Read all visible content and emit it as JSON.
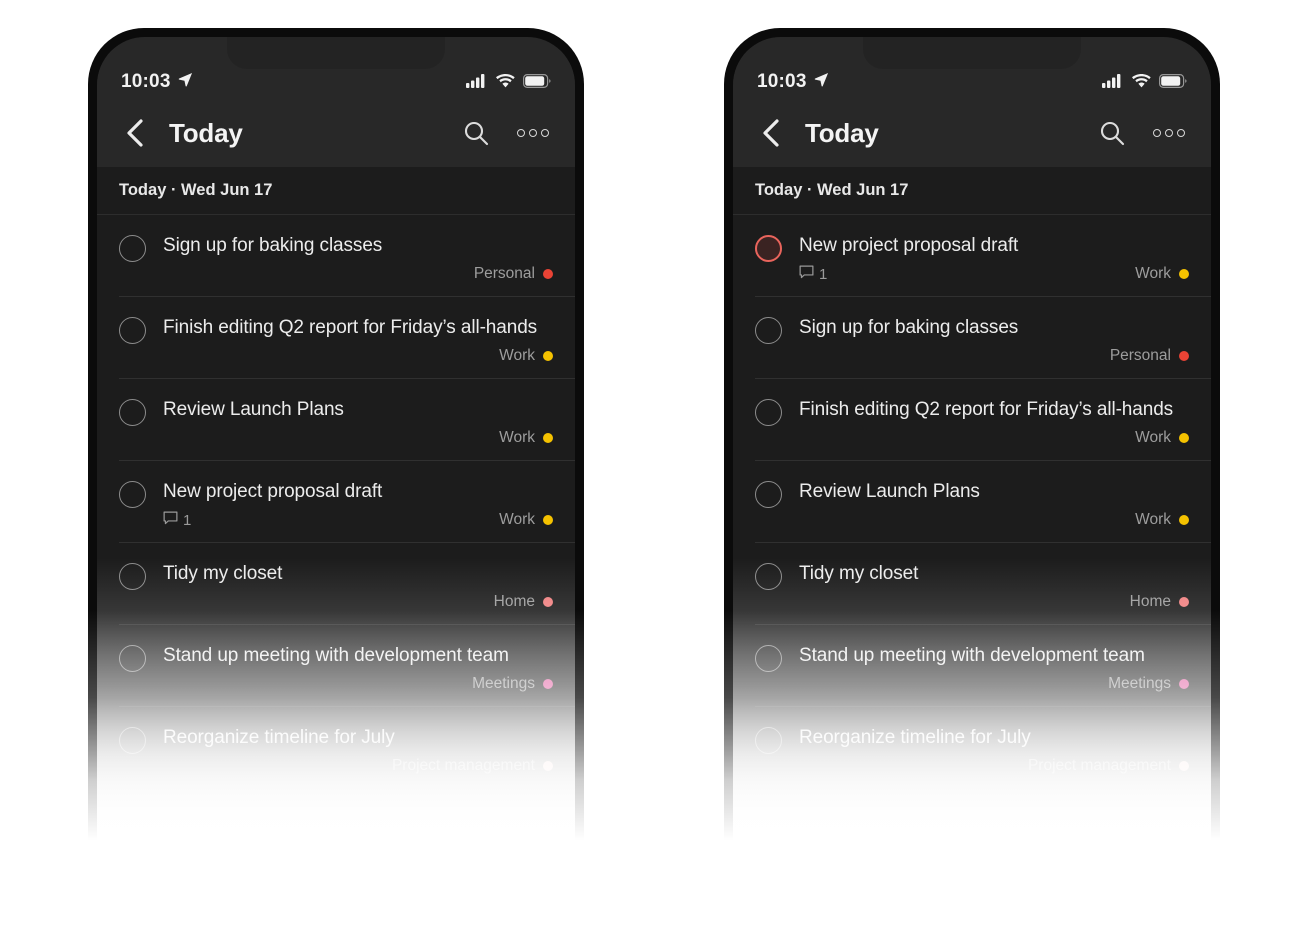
{
  "statusbar": {
    "time": "10:03",
    "location_icon": "location-arrow-icon",
    "signal_icon": "cellular-signal-icon",
    "wifi_icon": "wifi-icon",
    "battery_icon": "battery-icon"
  },
  "navbar": {
    "back_icon": "chevron-left-icon",
    "title": "Today",
    "search_icon": "search-icon",
    "more_icon": "more-options-icon"
  },
  "section": {
    "header": "Today · Wed Jun 17"
  },
  "colors": {
    "personal": "#e94335",
    "work": "#f5c200",
    "home": "#f08080",
    "meetings": "#e0559c",
    "project_management": "#f7b3ab",
    "selected_ring": "#e8645c",
    "selected_fill": "#3a2322",
    "screen_bg": "#1c1c1c",
    "bar_bg": "#282828",
    "divider": "#303030"
  },
  "phones": [
    {
      "name": "before",
      "tasks": [
        {
          "title": "Sign up for baking classes",
          "project": "Personal",
          "project_color": "#e94335",
          "comments": null,
          "selected": false
        },
        {
          "title": "Finish editing Q2 report for Friday’s all-hands",
          "project": "Work",
          "project_color": "#f5c200",
          "comments": null,
          "selected": false
        },
        {
          "title": "Review Launch Plans",
          "project": "Work",
          "project_color": "#f5c200",
          "comments": null,
          "selected": false
        },
        {
          "title": "New project proposal draft",
          "project": "Work",
          "project_color": "#f5c200",
          "comments": "1",
          "selected": false
        },
        {
          "title": "Tidy my closet",
          "project": "Home",
          "project_color": "#f08080",
          "comments": null,
          "selected": false
        },
        {
          "title": "Stand up meeting with development team",
          "project": "Meetings",
          "project_color": "#e0559c",
          "comments": null,
          "selected": false
        },
        {
          "title": "Reorganize timeline for July",
          "project": "Project management",
          "project_color": "#f7b3ab",
          "comments": null,
          "selected": false
        }
      ]
    },
    {
      "name": "after",
      "tasks": [
        {
          "title": "New project proposal draft",
          "project": "Work",
          "project_color": "#f5c200",
          "comments": "1",
          "selected": true
        },
        {
          "title": "Sign up for baking classes",
          "project": "Personal",
          "project_color": "#e94335",
          "comments": null,
          "selected": false
        },
        {
          "title": "Finish editing Q2 report for Friday’s all-hands",
          "project": "Work",
          "project_color": "#f5c200",
          "comments": null,
          "selected": false
        },
        {
          "title": "Review Launch Plans",
          "project": "Work",
          "project_color": "#f5c200",
          "comments": null,
          "selected": false
        },
        {
          "title": "Tidy my closet",
          "project": "Home",
          "project_color": "#f08080",
          "comments": null,
          "selected": false
        },
        {
          "title": "Stand up meeting with development team",
          "project": "Meetings",
          "project_color": "#e0559c",
          "comments": null,
          "selected": false
        },
        {
          "title": "Reorganize timeline for July",
          "project": "Project management",
          "project_color": "#f7b3ab",
          "comments": null,
          "selected": false
        }
      ]
    }
  ]
}
